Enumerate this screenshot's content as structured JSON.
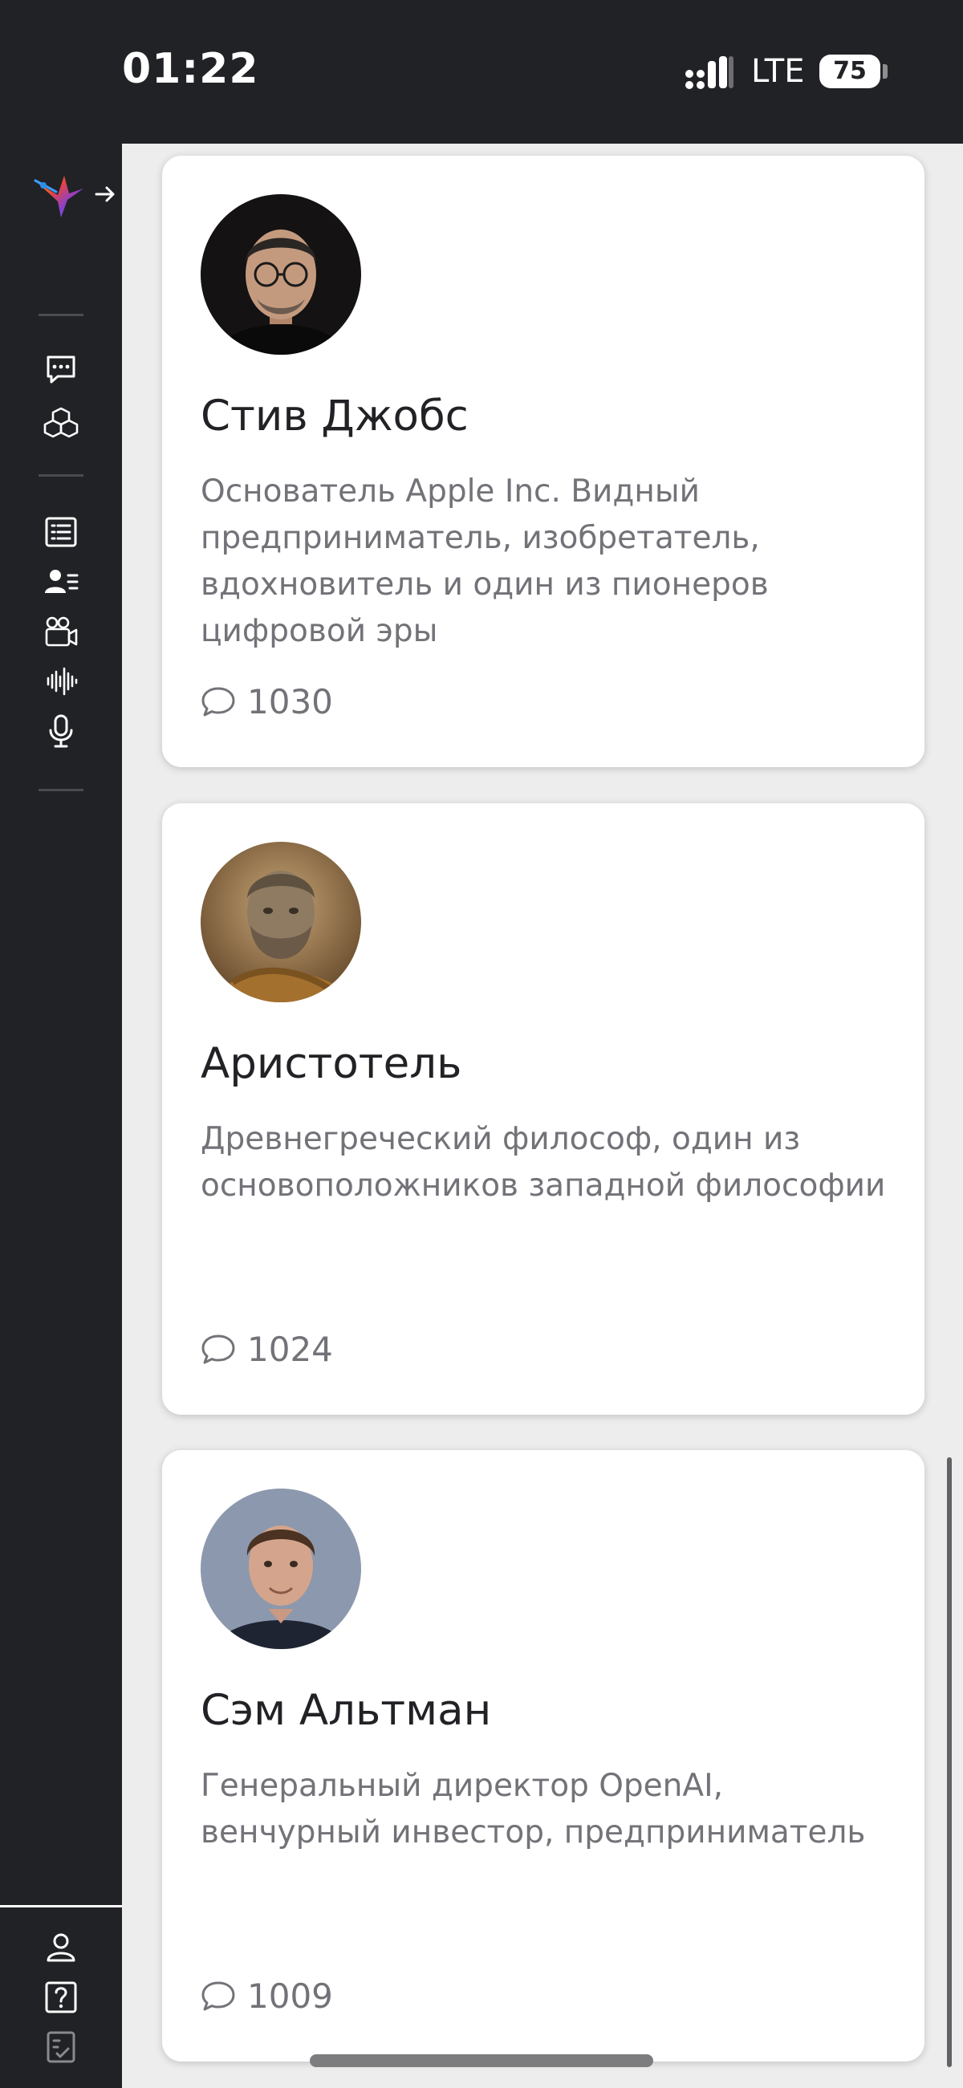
{
  "status_bar": {
    "time": "01:22",
    "network": "LTE",
    "battery": "75"
  },
  "sidebar": {
    "items": [
      {
        "name": "chat",
        "icon": "chat-bubble-icon"
      },
      {
        "name": "models",
        "icon": "cubes-icon"
      },
      {
        "name": "articles",
        "icon": "list-icon"
      },
      {
        "name": "personas",
        "icon": "user-list-icon"
      },
      {
        "name": "video",
        "icon": "video-camera-icon"
      },
      {
        "name": "audio",
        "icon": "soundwave-icon"
      },
      {
        "name": "voice",
        "icon": "microphone-icon"
      }
    ],
    "bottom_items": [
      {
        "name": "profile",
        "icon": "user-icon"
      },
      {
        "name": "help",
        "icon": "question-icon"
      },
      {
        "name": "tasks",
        "icon": "checklist-icon"
      }
    ]
  },
  "cards": [
    {
      "name": "Стив Джобс",
      "description": "Основатель Apple Inc. Видный предприниматель, изобретатель, вдохновитель и один из пионеров цифровой эры",
      "count": "1030"
    },
    {
      "name": "Аристотель",
      "description": "Древнегреческий философ, один из основоположников западной философии",
      "count": "1024"
    },
    {
      "name": "Сэм Альтман",
      "description": "Генеральный директор OpenAI, венчурный инвестор, предприниматель",
      "count": "1009"
    }
  ],
  "colors": {
    "sidebar": "#212226",
    "background": "#ededed",
    "card": "#ffffff",
    "text_primary": "#222226",
    "text_secondary": "#727278"
  }
}
